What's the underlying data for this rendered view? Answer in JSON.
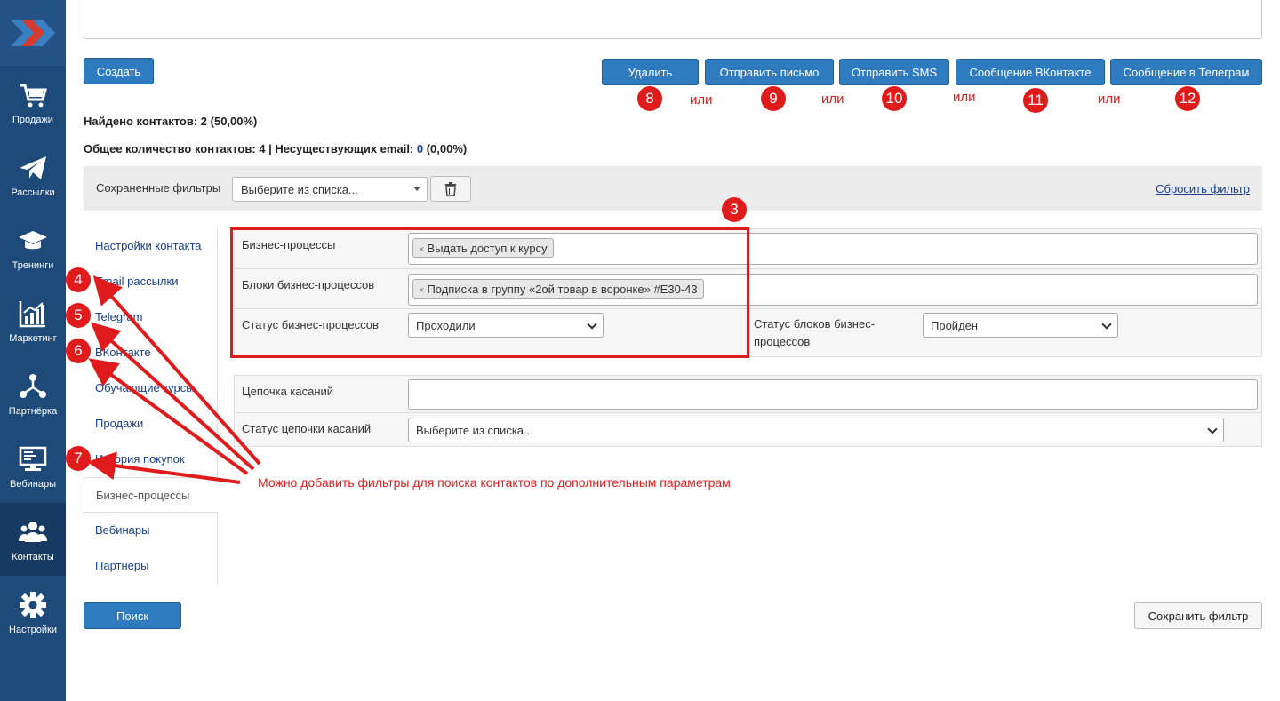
{
  "sidebar": {
    "items": [
      {
        "label": "Продажи",
        "icon": "cart-icon"
      },
      {
        "label": "Рассылки",
        "icon": "paper-plane-icon"
      },
      {
        "label": "Тренинги",
        "icon": "graduation-cap-icon"
      },
      {
        "label": "Маркетинг",
        "icon": "bar-chart-icon"
      },
      {
        "label": "Партнёрка",
        "icon": "network-icon"
      },
      {
        "label": "Вебинары",
        "icon": "presentation-icon"
      },
      {
        "label": "Контакты",
        "icon": "users-icon"
      },
      {
        "label": "Настройки",
        "icon": "gear-icon"
      }
    ],
    "active": "Контакты"
  },
  "toolbar": {
    "create_label": "Создать",
    "delete_label": "Удалить",
    "send_email_label": "Отправить письмо",
    "send_sms_label": "Отправить SMS",
    "vk_message_label": "Сообщение ВКонтакте",
    "telegram_message_label": "Сообщение в Телеграм"
  },
  "badges": {
    "b3": "3",
    "b4": "4",
    "b5": "5",
    "b6": "6",
    "b7": "7",
    "b8": "8",
    "b9": "9",
    "b10": "10",
    "b11": "11",
    "b12": "12"
  },
  "ili": "или",
  "summary": {
    "found_prefix": "Найдено контактов: 2 (50,00%)",
    "total_prefix": "Общее количество контактов: 4 | Несуществующих email: ",
    "nonexistent_count": "0",
    "nonexistent_pct": " (0,00%)"
  },
  "saved_filters": {
    "label": "Сохраненные фильтры",
    "placeholder": "Выберите из списка...",
    "reset_link": "Сбросить фильтр"
  },
  "tabs": [
    "Настройки контакта",
    "Email рассылки",
    "Telegram",
    "ВКонтакте",
    "Обучающие курсы",
    "Продажи",
    "История покупок",
    "Бизнес-процессы",
    "Вебинары",
    "Партнёры"
  ],
  "active_tab": "Бизнес-процессы",
  "form": {
    "bp_label": "Бизнес-процессы",
    "bp_chip": "Выдать доступ к курсу",
    "bp_blocks_label": "Блоки бизнес-процессов",
    "bp_blocks_chip": "Подписка в группу «2ой товар в воронке» #E30-43",
    "bp_status_label": "Статус бизнес-процессов",
    "bp_status_value": "Проходили",
    "bp_block_status_label_1": "Статус блоков бизнес-",
    "bp_block_status_label_2": "процессов",
    "bp_block_status_value": "Пройден",
    "chain_label": "Цепочка касаний",
    "chain_status_label": "Статус цепочки касаний",
    "chain_status_value": "Выберите из списка..."
  },
  "annotation": "Можно добавить фильтры для поиска контактов по дополнительным параметрам",
  "search_label": "Поиск",
  "save_filter_label": "Сохранить фильтр",
  "colors": {
    "sidebar": "#1e4a7a",
    "primary": "#2e7bbf",
    "annotation_red": "#e01b1b"
  }
}
